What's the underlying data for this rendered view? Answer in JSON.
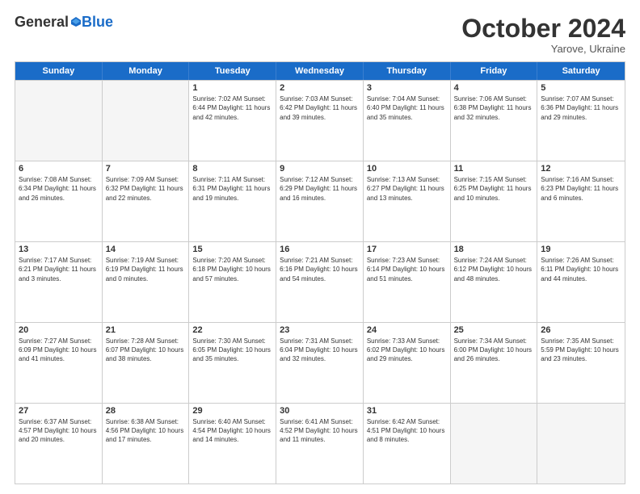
{
  "header": {
    "logo_general": "General",
    "logo_blue": "Blue",
    "month": "October 2024",
    "location": "Yarove, Ukraine"
  },
  "weekdays": [
    "Sunday",
    "Monday",
    "Tuesday",
    "Wednesday",
    "Thursday",
    "Friday",
    "Saturday"
  ],
  "rows": [
    [
      {
        "day": "",
        "info": "",
        "empty": true
      },
      {
        "day": "",
        "info": "",
        "empty": true
      },
      {
        "day": "1",
        "info": "Sunrise: 7:02 AM\nSunset: 6:44 PM\nDaylight: 11 hours and 42 minutes."
      },
      {
        "day": "2",
        "info": "Sunrise: 7:03 AM\nSunset: 6:42 PM\nDaylight: 11 hours and 39 minutes."
      },
      {
        "day": "3",
        "info": "Sunrise: 7:04 AM\nSunset: 6:40 PM\nDaylight: 11 hours and 35 minutes."
      },
      {
        "day": "4",
        "info": "Sunrise: 7:06 AM\nSunset: 6:38 PM\nDaylight: 11 hours and 32 minutes."
      },
      {
        "day": "5",
        "info": "Sunrise: 7:07 AM\nSunset: 6:36 PM\nDaylight: 11 hours and 29 minutes."
      }
    ],
    [
      {
        "day": "6",
        "info": "Sunrise: 7:08 AM\nSunset: 6:34 PM\nDaylight: 11 hours and 26 minutes."
      },
      {
        "day": "7",
        "info": "Sunrise: 7:09 AM\nSunset: 6:32 PM\nDaylight: 11 hours and 22 minutes."
      },
      {
        "day": "8",
        "info": "Sunrise: 7:11 AM\nSunset: 6:31 PM\nDaylight: 11 hours and 19 minutes."
      },
      {
        "day": "9",
        "info": "Sunrise: 7:12 AM\nSunset: 6:29 PM\nDaylight: 11 hours and 16 minutes."
      },
      {
        "day": "10",
        "info": "Sunrise: 7:13 AM\nSunset: 6:27 PM\nDaylight: 11 hours and 13 minutes."
      },
      {
        "day": "11",
        "info": "Sunrise: 7:15 AM\nSunset: 6:25 PM\nDaylight: 11 hours and 10 minutes."
      },
      {
        "day": "12",
        "info": "Sunrise: 7:16 AM\nSunset: 6:23 PM\nDaylight: 11 hours and 6 minutes."
      }
    ],
    [
      {
        "day": "13",
        "info": "Sunrise: 7:17 AM\nSunset: 6:21 PM\nDaylight: 11 hours and 3 minutes."
      },
      {
        "day": "14",
        "info": "Sunrise: 7:19 AM\nSunset: 6:19 PM\nDaylight: 11 hours and 0 minutes."
      },
      {
        "day": "15",
        "info": "Sunrise: 7:20 AM\nSunset: 6:18 PM\nDaylight: 10 hours and 57 minutes."
      },
      {
        "day": "16",
        "info": "Sunrise: 7:21 AM\nSunset: 6:16 PM\nDaylight: 10 hours and 54 minutes."
      },
      {
        "day": "17",
        "info": "Sunrise: 7:23 AM\nSunset: 6:14 PM\nDaylight: 10 hours and 51 minutes."
      },
      {
        "day": "18",
        "info": "Sunrise: 7:24 AM\nSunset: 6:12 PM\nDaylight: 10 hours and 48 minutes."
      },
      {
        "day": "19",
        "info": "Sunrise: 7:26 AM\nSunset: 6:11 PM\nDaylight: 10 hours and 44 minutes."
      }
    ],
    [
      {
        "day": "20",
        "info": "Sunrise: 7:27 AM\nSunset: 6:09 PM\nDaylight: 10 hours and 41 minutes."
      },
      {
        "day": "21",
        "info": "Sunrise: 7:28 AM\nSunset: 6:07 PM\nDaylight: 10 hours and 38 minutes."
      },
      {
        "day": "22",
        "info": "Sunrise: 7:30 AM\nSunset: 6:05 PM\nDaylight: 10 hours and 35 minutes."
      },
      {
        "day": "23",
        "info": "Sunrise: 7:31 AM\nSunset: 6:04 PM\nDaylight: 10 hours and 32 minutes."
      },
      {
        "day": "24",
        "info": "Sunrise: 7:33 AM\nSunset: 6:02 PM\nDaylight: 10 hours and 29 minutes."
      },
      {
        "day": "25",
        "info": "Sunrise: 7:34 AM\nSunset: 6:00 PM\nDaylight: 10 hours and 26 minutes."
      },
      {
        "day": "26",
        "info": "Sunrise: 7:35 AM\nSunset: 5:59 PM\nDaylight: 10 hours and 23 minutes."
      }
    ],
    [
      {
        "day": "27",
        "info": "Sunrise: 6:37 AM\nSunset: 4:57 PM\nDaylight: 10 hours and 20 minutes."
      },
      {
        "day": "28",
        "info": "Sunrise: 6:38 AM\nSunset: 4:56 PM\nDaylight: 10 hours and 17 minutes."
      },
      {
        "day": "29",
        "info": "Sunrise: 6:40 AM\nSunset: 4:54 PM\nDaylight: 10 hours and 14 minutes."
      },
      {
        "day": "30",
        "info": "Sunrise: 6:41 AM\nSunset: 4:52 PM\nDaylight: 10 hours and 11 minutes."
      },
      {
        "day": "31",
        "info": "Sunrise: 6:42 AM\nSunset: 4:51 PM\nDaylight: 10 hours and 8 minutes."
      },
      {
        "day": "",
        "info": "",
        "empty": true
      },
      {
        "day": "",
        "info": "",
        "empty": true
      }
    ]
  ]
}
